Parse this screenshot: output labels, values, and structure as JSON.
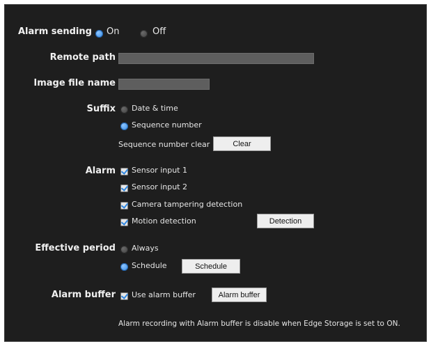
{
  "alarm_sending": {
    "label": "Alarm sending",
    "on": "On",
    "off": "Off",
    "selected": "On"
  },
  "remote_path": {
    "label": "Remote path",
    "value": ""
  },
  "image_file_name": {
    "label": "Image file name",
    "value": ""
  },
  "suffix": {
    "label": "Suffix",
    "options": [
      "Date & time",
      "Sequence number"
    ],
    "selected": "Sequence number",
    "clear_label": "Sequence number clear",
    "clear_button": "Clear"
  },
  "alarm": {
    "label": "Alarm",
    "items": [
      {
        "label": "Sensor input 1",
        "checked": true
      },
      {
        "label": "Sensor input 2",
        "checked": true
      },
      {
        "label": "Camera tampering detection",
        "checked": true
      },
      {
        "label": "Motion detection",
        "checked": true
      }
    ],
    "detection_button": "Detection"
  },
  "effective_period": {
    "label": "Effective period",
    "options": [
      "Always",
      "Schedule"
    ],
    "selected": "Schedule",
    "schedule_button": "Schedule"
  },
  "alarm_buffer": {
    "label": "Alarm buffer",
    "use_label": "Use alarm buffer",
    "checked": true,
    "button": "Alarm buffer",
    "note": "Alarm recording with Alarm buffer is disable when Edge Storage is set to ON."
  },
  "colors": {
    "panel_bg": "#1e1e1e",
    "accent": "#2f86e0",
    "input_bg": "#5e5e5e"
  }
}
